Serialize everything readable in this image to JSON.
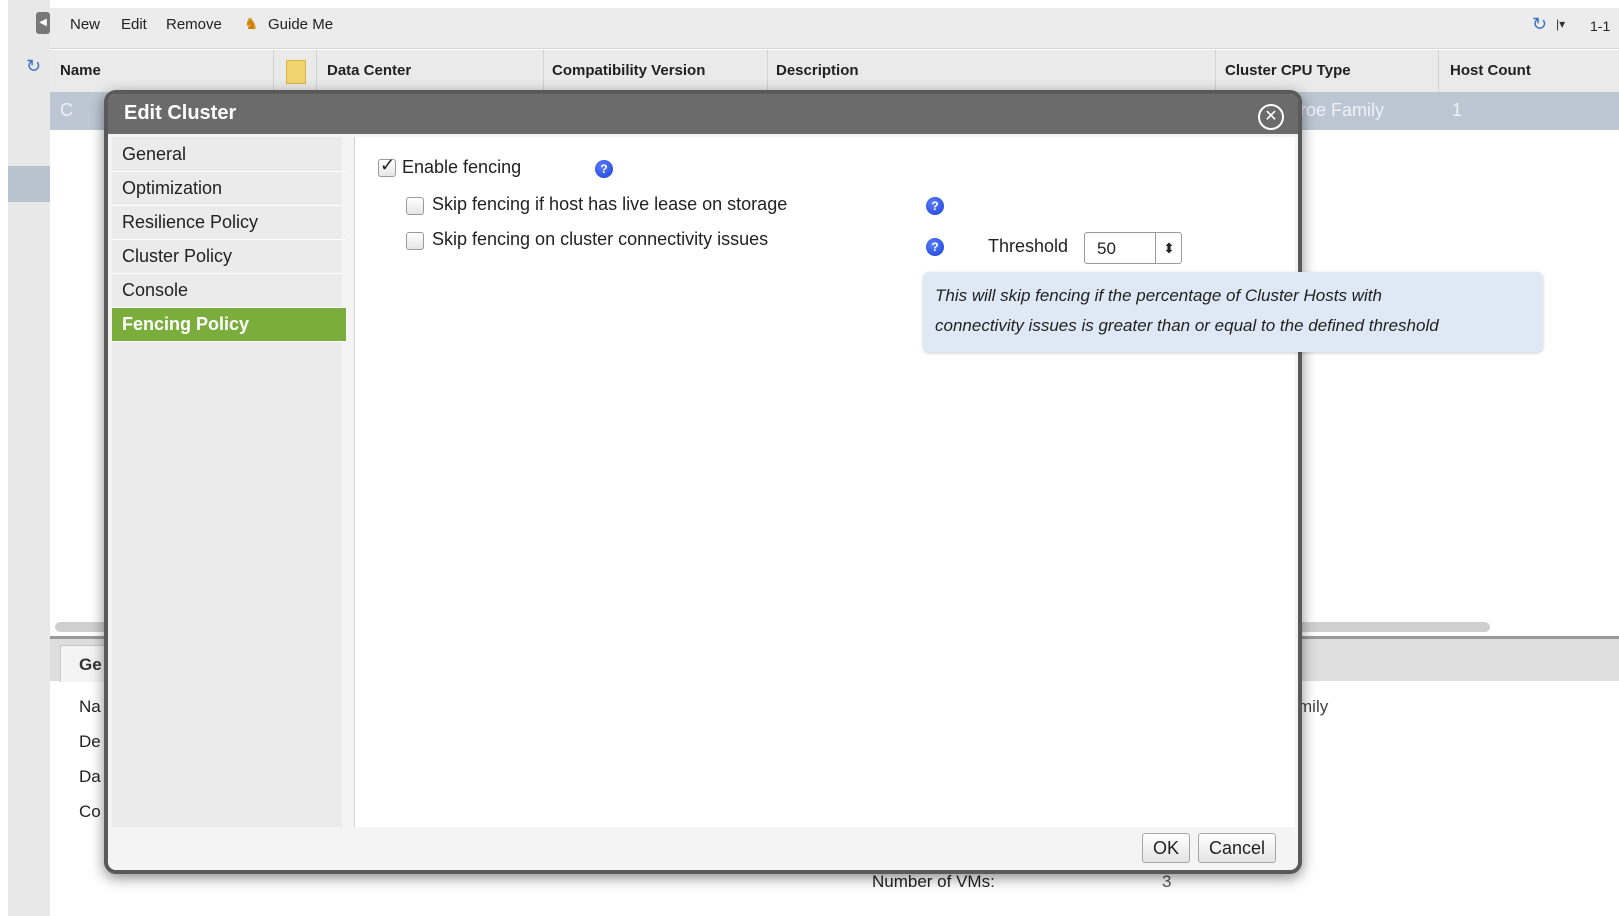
{
  "toolbar": {
    "new": "New",
    "edit": "Edit",
    "remove": "Remove",
    "guide": "Guide Me",
    "pager": "1-1"
  },
  "grid": {
    "columns": [
      "Name",
      "Data Center",
      "Compatibility Version",
      "Description",
      "Cluster CPU Type",
      "Host Count"
    ],
    "row": {
      "name": "C",
      "cpu": "roe Family",
      "hosts": "1"
    }
  },
  "details": {
    "tab": "Ge",
    "labels": [
      "Na",
      "De",
      "Da",
      "Co"
    ],
    "cpu_suffix": "mily",
    "vms_label": "Number of VMs:",
    "vms_value": "3"
  },
  "dialog": {
    "title": "Edit Cluster",
    "nav": [
      "General",
      "Optimization",
      "Resilience Policy",
      "Cluster Policy",
      "Console",
      "Fencing Policy"
    ],
    "selected_nav": "Fencing Policy",
    "enable_fencing": {
      "label": "Enable fencing",
      "checked": true
    },
    "skip_lease": {
      "label": "Skip fencing if host has live lease on storage",
      "checked": false
    },
    "skip_connectivity": {
      "label": "Skip fencing on cluster connectivity issues",
      "checked": false
    },
    "threshold": {
      "label": "Threshold",
      "value": "50"
    },
    "tooltip": [
      "This will skip fencing if the percentage of Cluster Hosts with",
      "connectivity issues is greater than or equal to the defined threshold"
    ],
    "ok": "OK",
    "cancel": "Cancel"
  },
  "colors": {
    "accent": "#7bad3c",
    "title_bar": "#6b6b6b",
    "tooltip_bg": "#dfe9f6",
    "help_icon": "#1a3fd0"
  }
}
